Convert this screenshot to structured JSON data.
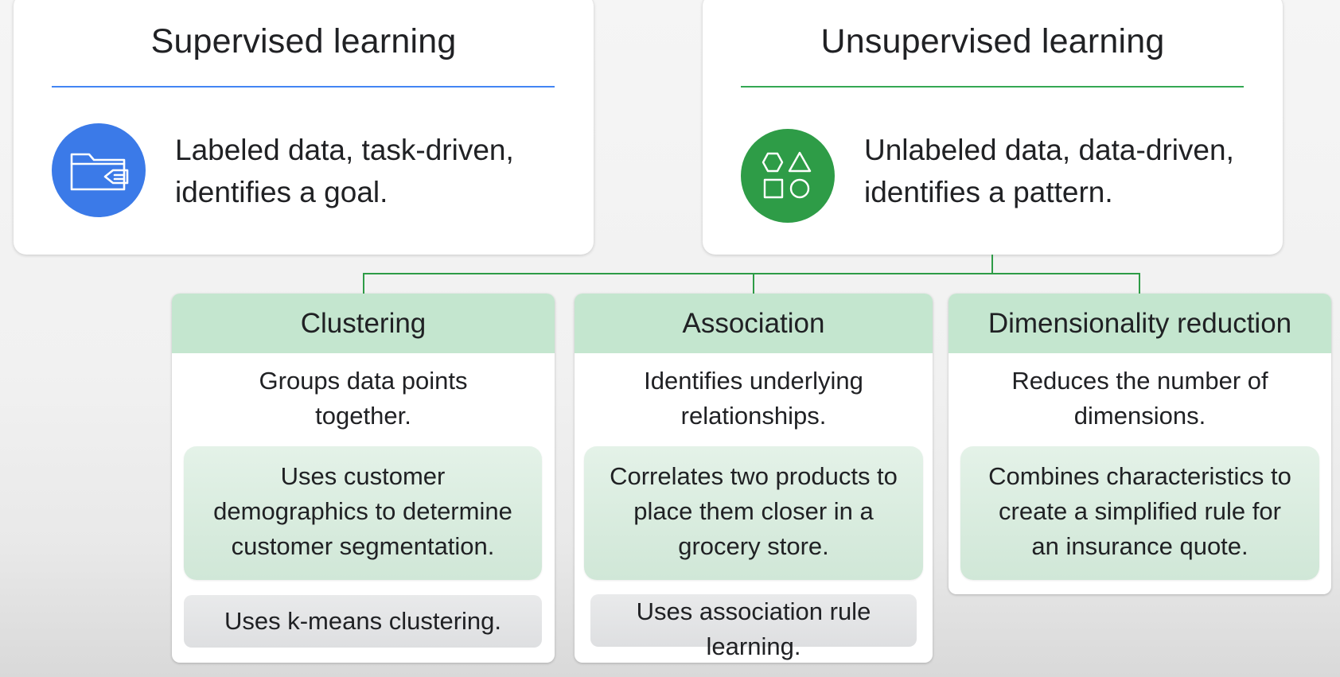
{
  "supervised": {
    "title": "Supervised learning",
    "icon": "folder-icon",
    "description_line1": "Labeled data, task-driven,",
    "description_line2": "identifies a goal.",
    "accent_color": "#4285f4"
  },
  "unsupervised": {
    "title": "Unsupervised learning",
    "icon": "shapes-icon",
    "description_line1": "Unlabeled data, data-driven,",
    "description_line2": "identifies a pattern.",
    "accent_color": "#34a853"
  },
  "types": [
    {
      "title": "Clustering",
      "description_line1": "Groups data points",
      "description_line2": "together.",
      "example_line1": "Uses customer",
      "example_line2": "demographics to determine",
      "example_line3": "customer segmentation.",
      "method": "Uses k-means clustering."
    },
    {
      "title": "Association",
      "description_line1": "Identifies underlying",
      "description_line2": "relationships.",
      "example_line1": "Correlates two products to",
      "example_line2": "place them closer in a",
      "example_line3": "grocery store.",
      "method_line1": "Uses association rule",
      "method_line2": "learning."
    },
    {
      "title": "Dimensionality reduction",
      "description_line1": "Reduces the number of",
      "description_line2": "dimensions.",
      "example_line1": "Combines characteristics to",
      "example_line2": "create a simplified rule for",
      "example_line3": "an insurance quote."
    }
  ]
}
